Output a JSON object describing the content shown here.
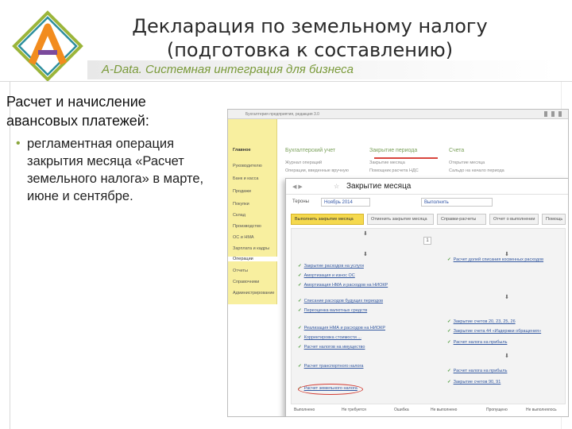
{
  "slide": {
    "title_line1": "Декларация по земельному налогу",
    "title_line2": "(подготовка к составлению)",
    "brand": "A-Data. Системная интеграция для бизнеса",
    "logo_letter": "A",
    "heading_line1": "Расчет и начисление",
    "heading_line2": "авансовых платежей:",
    "bullet_text": "регламентная операция закрытия месяца «Расчет земельного налога» в марте, июне и сентябре.",
    "colors": {
      "accent_green": "#8aa63c",
      "brand_text": "#7a9a3a",
      "logo_orange": "#f28c1e",
      "highlight_red": "#d23b33"
    }
  },
  "screenshot": {
    "window_title": "Бухгалтерия предприятия, редакция 3.0",
    "sidebar": [
      {
        "label": "Главное",
        "bold": true
      },
      {
        "label": "Руководителю"
      },
      {
        "label": "Банк и касса"
      },
      {
        "label": "Продажи"
      },
      {
        "label": "Покупки"
      },
      {
        "label": "Склад"
      },
      {
        "label": "Производство"
      },
      {
        "label": "ОС и НМА"
      },
      {
        "label": "Зарплата и кадры"
      },
      {
        "label": "Операции",
        "selected": true
      },
      {
        "label": "Отчеты"
      },
      {
        "label": "Справочники"
      },
      {
        "label": "Администрирование"
      }
    ],
    "bg_sections": [
      {
        "head": "Бухгалтерский учет",
        "items": [
          "Журнал операций",
          "Операции, введенные вручную"
        ]
      },
      {
        "head": "Закрытие периода",
        "items": [
          "Закрытие месяца",
          "Помощник расчета НДС"
        ]
      },
      {
        "head": "Счета",
        "items": [
          "Открытие месяца",
          "Сальдо на начало периода"
        ]
      }
    ],
    "modal": {
      "title": "Закрытие месяца",
      "org_label": "Тероны",
      "period": "Ноябрь 2014",
      "org_value": "Выполнить",
      "tabs": [
        {
          "label": "Выполнить закрытие месяца",
          "active": true
        },
        {
          "label": "Отменить закрытие месяца"
        },
        {
          "label": "Справки-расчеты"
        },
        {
          "label": "Отчет о выполнении"
        },
        {
          "label": "Помощь"
        }
      ],
      "operations_left": [
        "Закрытие расходов на услуги",
        "Амортизация и износ ОС",
        "Амортизация НМА и расходов на НИОКР",
        "Списание расходов будущих периодов",
        "Переоценка валютных средств",
        "Реализация НМА и расходов на НИОКР",
        "Корректировка стоимости ...",
        "Расчет налогов на имущество",
        "Расчет транспортного налога",
        "Расчет земельного налога"
      ],
      "operations_right": [
        "Расчет долей списания косвенных расходов",
        "Закрытие счетов 20, 23, 25, 26",
        "Закрытие счета 44 «Издержки обращения»",
        "Расчет налога на прибыль",
        "Расчет налога на прибыль",
        "Закрытие счетов 90, 91"
      ],
      "step_number": "1",
      "footer": [
        "Выполнено",
        "Не требуется",
        "Ошибка",
        "Не выполнено",
        "Пропущено",
        "Не выполнялось"
      ]
    }
  }
}
